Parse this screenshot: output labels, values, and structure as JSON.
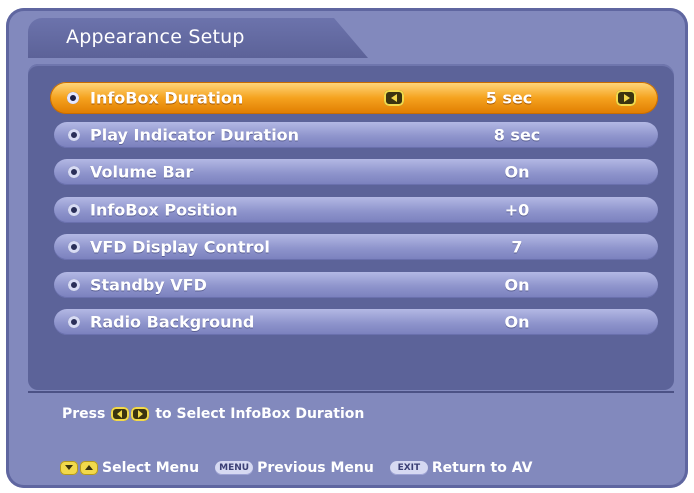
{
  "window": {
    "title": "Appearance Setup"
  },
  "menu": {
    "items": [
      {
        "label": "InfoBox Duration",
        "value": "5 sec",
        "selected": true
      },
      {
        "label": "Play Indicator Duration",
        "value": "8 sec",
        "selected": false
      },
      {
        "label": "Volume Bar",
        "value": "On",
        "selected": false
      },
      {
        "label": "InfoBox Position",
        "value": "+0",
        "selected": false
      },
      {
        "label": "VFD Display Control",
        "value": "7",
        "selected": false
      },
      {
        "label": "Standby VFD",
        "value": "On",
        "selected": false
      },
      {
        "label": "Radio Background",
        "value": "On",
        "selected": false
      }
    ]
  },
  "hint": {
    "press": "Press",
    "action": "to Select InfoBox Duration"
  },
  "footer": {
    "select_menu": "Select Menu",
    "menu_key": "MENU",
    "previous_menu": "Previous Menu",
    "exit_key": "EXIT",
    "return_to_av": "Return to AV"
  },
  "colors": {
    "background": "#8289bd",
    "panel": "#5c6399",
    "row": "#9aa0d6",
    "selected_row": "#f5a21e",
    "key_yellow": "#f2d94b"
  },
  "icons": {
    "bullet": "bullet-icon",
    "left": "left-arrow-icon",
    "right": "right-arrow-icon",
    "up": "up-arrow-icon",
    "down": "down-arrow-icon"
  }
}
